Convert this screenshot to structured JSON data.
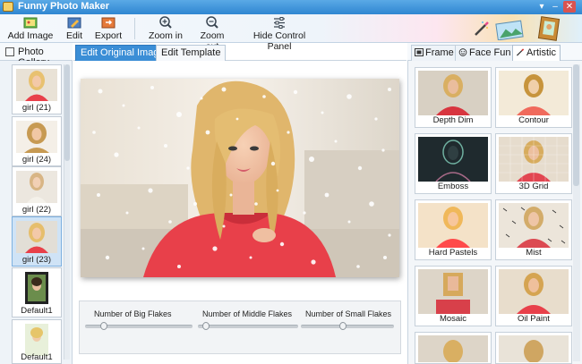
{
  "window": {
    "title": "Funny Photo Maker"
  },
  "toolbar": {
    "add_image": "Add Image",
    "edit": "Edit",
    "export": "Export",
    "zoom_in": "Zoom in",
    "zoom_out": "Zoom out",
    "hide_control_panel": "Hide Control Panel"
  },
  "gallery": {
    "header": "Photo Gallery",
    "items": [
      {
        "label": "girl (21)"
      },
      {
        "label": "girl (24)"
      },
      {
        "label": "girl (22)"
      },
      {
        "label": "girl (23)"
      },
      {
        "label": "Default1"
      },
      {
        "label": "Default1"
      }
    ]
  },
  "editor": {
    "tabs": [
      "Edit Original Image",
      "Edit Template"
    ],
    "controls": {
      "big_flakes": "Number of Big Flakes",
      "middle_flakes": "Number of Middle Flakes",
      "small_flakes": "Number of Small Flakes",
      "big_level": 0.15,
      "middle_level": 0.05,
      "small_level": 0.45
    }
  },
  "effects_panel": {
    "tabs": [
      "Frame",
      "Face Fun",
      "Artistic"
    ],
    "items": [
      {
        "label": "Depth Dim"
      },
      {
        "label": "Contour"
      },
      {
        "label": "Emboss"
      },
      {
        "label": "3D Grid"
      },
      {
        "label": "Hard Pastels"
      },
      {
        "label": "Mist"
      },
      {
        "label": "Mosaic"
      },
      {
        "label": "Oil Paint"
      }
    ]
  },
  "colors": {
    "accent": "#3b8ed6",
    "title_bar": "#2f86d1",
    "sweater": "#e8404a"
  }
}
